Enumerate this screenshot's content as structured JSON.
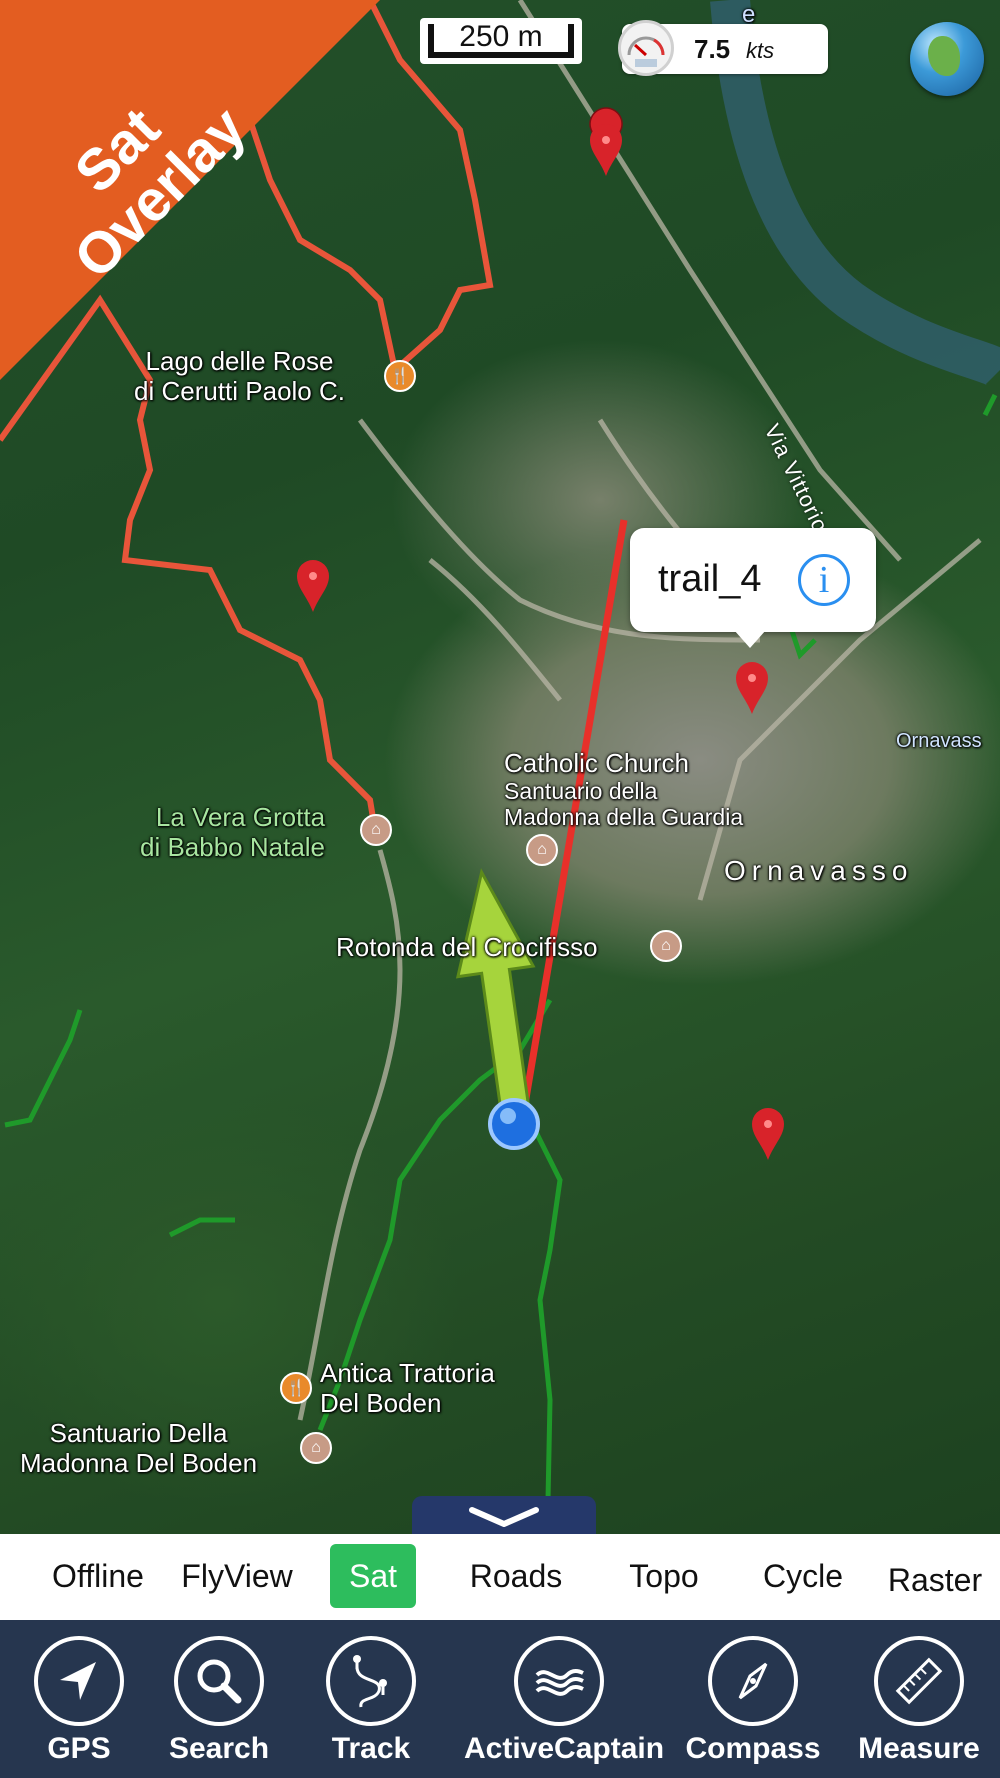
{
  "banner": {
    "line1": "Sat",
    "line2": "Overlay",
    "color": "#e35d21"
  },
  "scale_bar": {
    "label": "250 m"
  },
  "speed": {
    "value": "7.5",
    "unit": "kts"
  },
  "map_labels": {
    "lago": "Lago delle Rose\ndi Cerutti Paolo C.",
    "grotta": "La Vera Grotta\ndi Babbo Natale",
    "church_title": "Catholic Church",
    "church_sub": "Santuario della\nMadonna della Guardia",
    "ornavasso": "Ornavasso",
    "ornavasso_edge": "Ornavass",
    "rotonda": "Rotonda del Crocifisso",
    "trattoria": "Antica Trattoria\nDel Boden",
    "santuario_boden": "Santuario Della\nMadonna Del Boden",
    "road": "Via Vittorio Veneto",
    "river_mark": "e"
  },
  "popup": {
    "name": "trail_4"
  },
  "layer_tabs": [
    {
      "label": "Offline",
      "active": false
    },
    {
      "label": "FlyView",
      "active": false
    },
    {
      "label": "Sat",
      "active": true
    },
    {
      "label": "Roads",
      "active": false
    },
    {
      "label": "Topo",
      "active": false
    },
    {
      "label": "Cycle",
      "active": false
    },
    {
      "label": "Raster",
      "active": false
    }
  ],
  "toolbar": [
    {
      "label": "GPS",
      "icon": "navigation-arrow-icon"
    },
    {
      "label": "Search",
      "icon": "magnifier-icon"
    },
    {
      "label": "Track",
      "icon": "track-path-icon"
    },
    {
      "label": "ActiveCaptain",
      "icon": "waves-icon"
    },
    {
      "label": "Compass",
      "icon": "compass-icon"
    },
    {
      "label": "Measure",
      "icon": "ruler-icon"
    }
  ],
  "colors": {
    "track_red": "#e8553a",
    "trail_green": "#1f9a2a",
    "active_tab": "#2dbd5d",
    "toolbar_bg": "#26364f",
    "popup_info": "#2a8ff0"
  }
}
